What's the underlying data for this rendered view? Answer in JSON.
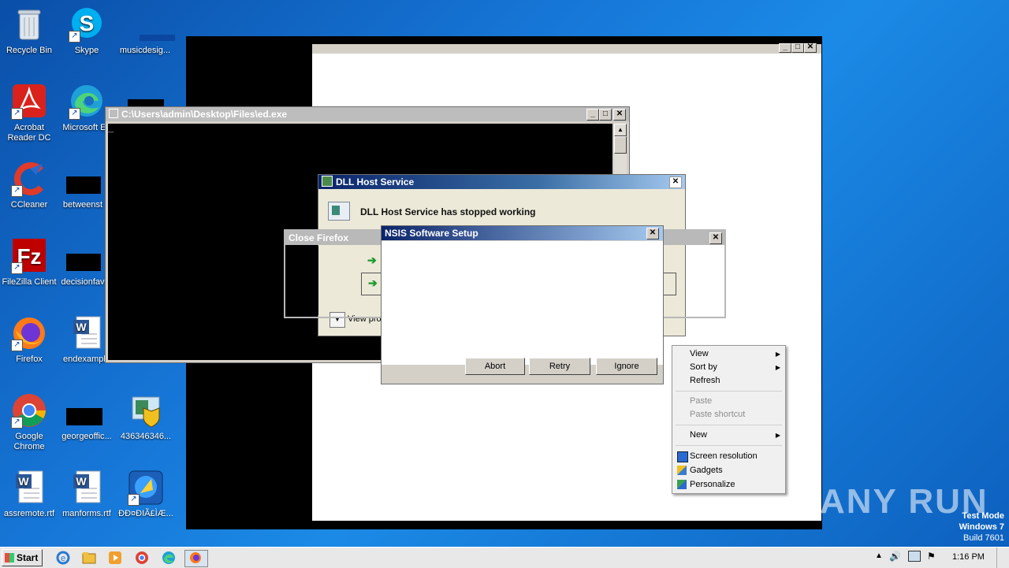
{
  "desktop_icons": [
    {
      "label": "Recycle Bin",
      "icon": "recycle-bin-icon"
    },
    {
      "label": "Skype",
      "icon": "skype-icon"
    },
    {
      "label": "musicdesig...",
      "icon": "file-icon"
    },
    {
      "label": "Acrobat Reader DC",
      "icon": "acrobat-icon"
    },
    {
      "label": "Microsoft Ed",
      "icon": "edge-icon"
    },
    {
      "label": "CCleaner",
      "icon": "ccleaner-icon"
    },
    {
      "label": "betweenst",
      "icon": "file-icon"
    },
    {
      "label": "FileZilla Client",
      "icon": "filezilla-icon"
    },
    {
      "label": "decisionfav",
      "icon": "file-icon"
    },
    {
      "label": "Firefox",
      "icon": "firefox-icon"
    },
    {
      "label": "endexample",
      "icon": "word-doc-icon"
    },
    {
      "label": "Google Chrome",
      "icon": "chrome-icon"
    },
    {
      "label": "georgeoffic...",
      "icon": "file-icon"
    },
    {
      "label": "436346346...",
      "icon": "installer-icon"
    },
    {
      "label": "assremote.rtf",
      "icon": "word-doc-icon"
    },
    {
      "label": "manforms.rtf",
      "icon": "word-doc-icon"
    },
    {
      "label": "ÐÐ¤ÐIÃ£ÌÆ...",
      "icon": "setup-icon"
    }
  ],
  "console_window": {
    "title": "C:\\Users\\admin\\Desktop\\Files\\ed.exe",
    "cursor": "_"
  },
  "dll_dialog": {
    "title": "DLL Host Service",
    "message": "DLL Host Service has stopped working",
    "view_problem": "View pro"
  },
  "firefox_dialog": {
    "title": "Close Firefox"
  },
  "nsis_dialog": {
    "title": "NSIS Software Setup",
    "buttons": [
      "Abort",
      "Retry",
      "Ignore"
    ]
  },
  "context_menu": {
    "view": "View",
    "sort_by": "Sort by",
    "refresh": "Refresh",
    "paste": "Paste",
    "paste_shortcut": "Paste shortcut",
    "new": "New",
    "screen_resolution": "Screen resolution",
    "gadgets": "Gadgets",
    "personalize": "Personalize"
  },
  "watermark": {
    "text": "ANY RUN",
    "mode": "Test Mode",
    "os": "Windows 7",
    "build": "Build 7601"
  },
  "taskbar": {
    "start": "Start",
    "time": "1:16 PM"
  }
}
